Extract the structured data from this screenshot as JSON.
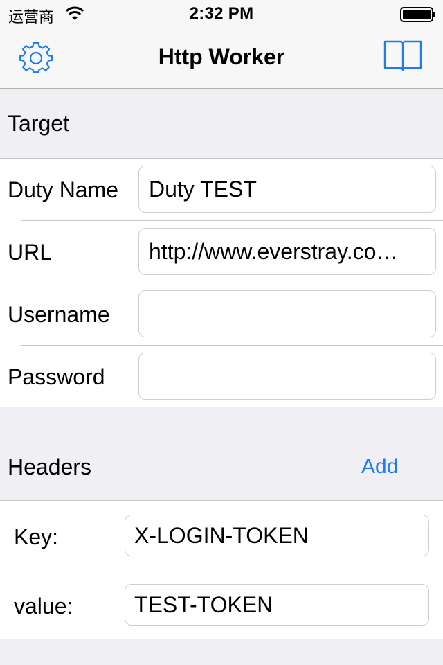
{
  "status_bar": {
    "carrier": "运营商",
    "time": "2:32 PM",
    "wifi_icon": "wifi-icon",
    "battery_icon": "battery-icon"
  },
  "nav": {
    "title": "Http Worker",
    "left_icon": "gear-icon",
    "right_icon": "book-icon",
    "accent_color": "#1f7bf2"
  },
  "target": {
    "section_title": "Target",
    "fields": {
      "duty_name": {
        "label": "Duty Name",
        "value": "Duty TEST"
      },
      "url": {
        "label": "URL",
        "value": "http://www.everstray.co…"
      },
      "username": {
        "label": "Username",
        "value": ""
      },
      "password": {
        "label": "Password",
        "value": ""
      }
    }
  },
  "headers": {
    "section_title": "Headers",
    "add_label": "Add",
    "items": [
      {
        "key_label": "Key:",
        "key": "X-LOGIN-TOKEN",
        "value_label": "value:",
        "value": "TEST-TOKEN"
      }
    ]
  }
}
